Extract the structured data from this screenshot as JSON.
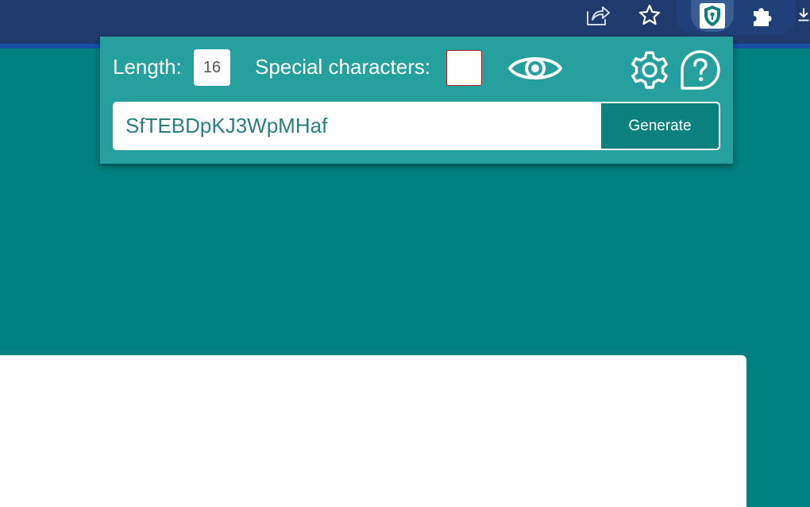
{
  "browser_toolbar": {
    "icons": {
      "share": "share-icon",
      "bookmark": "star-icon",
      "extension": "password-generator-extension-icon",
      "extensions_menu": "puzzle-icon",
      "download": "download-icon"
    }
  },
  "popup": {
    "length_label": "Length:",
    "length_value": "16",
    "special_label": "Special characters:",
    "special_checked": false,
    "password_value": "SfTEBDpKJ3WpMHaf",
    "generate_label": "Generate",
    "icons": {
      "show_password": "eye-icon",
      "settings": "gear-icon",
      "help": "help-icon"
    }
  },
  "colors": {
    "page_background": "#008080",
    "popup_background": "#25a09e",
    "generate_button": "#0c807e",
    "toolbar": "#1f3b6e",
    "password_text": "#2b7e80"
  }
}
